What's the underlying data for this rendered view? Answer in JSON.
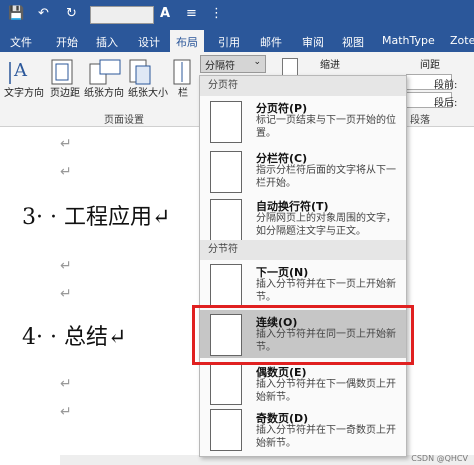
{
  "tabs": [
    "文件",
    "开始",
    "插入",
    "设计",
    "布局",
    "引用",
    "邮件",
    "审阅",
    "视图",
    "MathType",
    "Zote"
  ],
  "active_tab": "布局",
  "ribbon": {
    "buttons": [
      "文字方向",
      "页边距",
      "纸张方向",
      "纸张大小",
      "栏"
    ],
    "breaks_button": "分隔符",
    "indent_label": "缩进",
    "spacing_label": "间距",
    "before_label": "段前:",
    "after_label": "段后:",
    "group_page_setup": "页面设置",
    "group_paragraph": "段落"
  },
  "document": {
    "heading1": "3· · 工程应用↵",
    "heading2": "4· · 总结↵",
    "mark": "↵"
  },
  "menu": {
    "section_page": "分页符",
    "section_section": "分节符",
    "items": [
      {
        "name": "分页符(P)",
        "desc": "标记一页结束与下一页开始的位置。"
      },
      {
        "name": "分栏符(C)",
        "desc": "指示分栏符后面的文字将从下一栏开始。"
      },
      {
        "name": "自动换行符(T)",
        "desc": "分隔网页上的对象周围的文字，如分隔题注文字与正文。"
      },
      {
        "name": "下一页(N)",
        "desc": "插入分节符并在下一页上开始新节。"
      },
      {
        "name": "连续(O)",
        "desc": "插入分节符并在同一页上开始新节。"
      },
      {
        "name": "偶数页(E)",
        "desc": "插入分节符并在下一偶数页上开始新节。"
      },
      {
        "name": "奇数页(D)",
        "desc": "插入分节符并在下一奇数页上开始新节。"
      }
    ]
  },
  "watermark": "CSDN @QHCV"
}
